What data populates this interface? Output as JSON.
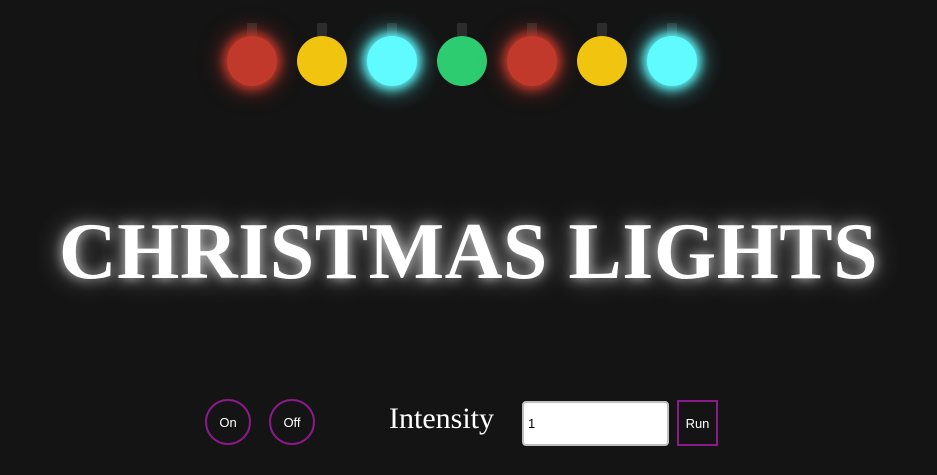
{
  "lights": [
    {
      "color": "#c0392b",
      "glow": true
    },
    {
      "color": "#f1c40f",
      "glow": false
    },
    {
      "color": "#5ffbff",
      "glow": true
    },
    {
      "color": "#2ecc71",
      "glow": false
    },
    {
      "color": "#c0392b",
      "glow": true
    },
    {
      "color": "#f1c40f",
      "glow": false
    },
    {
      "color": "#5ffbff",
      "glow": true
    }
  ],
  "title": "CHRISTMAS LIGHTS",
  "controls": {
    "on_label": "On",
    "off_label": "Off",
    "intensity_label": "Intensity",
    "intensity_value": "1",
    "run_label": "Run"
  },
  "colors": {
    "background": "#141414",
    "button_border": "#8b1a8b",
    "text": "#ffffff"
  }
}
